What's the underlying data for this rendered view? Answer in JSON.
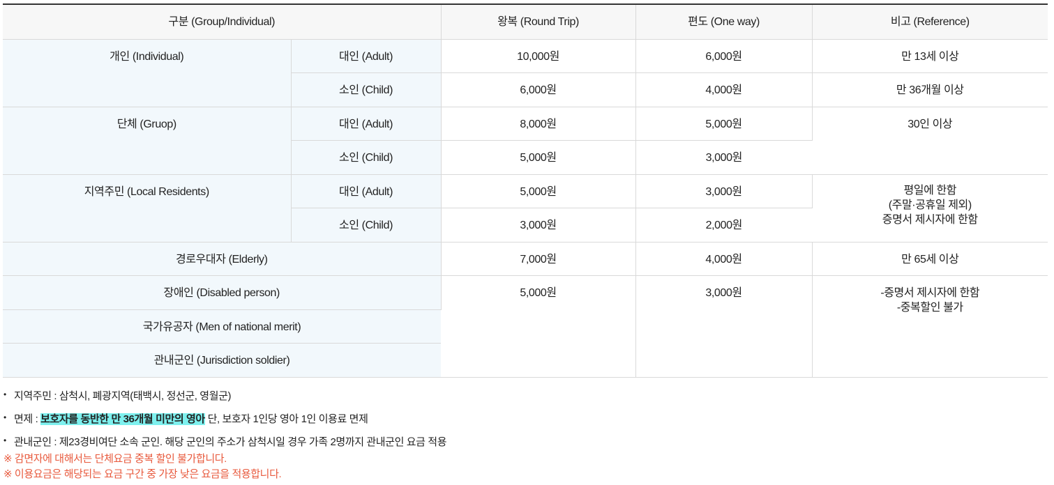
{
  "table": {
    "headers": {
      "group": "구분 (Group/Individual)",
      "round_trip": "왕복 (Round Trip)",
      "one_way": "편도 (One way)",
      "reference": "비고 (Reference)"
    },
    "individual": {
      "label": "개인 (Individual)",
      "adult": {
        "label": "대인 (Adult)",
        "round": "10,000원",
        "oneway": "6,000원",
        "ref": "만 13세 이상"
      },
      "child": {
        "label": "소인 (Child)",
        "round": "6,000원",
        "oneway": "4,000원",
        "ref": "만 36개월 이상"
      }
    },
    "group": {
      "label": "단체 (Gruop)",
      "adult": {
        "label": "대인 (Adult)",
        "round": "8,000원",
        "oneway": "5,000원"
      },
      "child": {
        "label": "소인 (Child)",
        "round": "5,000원",
        "oneway": "3,000원"
      },
      "ref": "30인 이상"
    },
    "local": {
      "label": "지역주민 (Local Residents)",
      "adult": {
        "label": "대인 (Adult)",
        "round": "5,000원",
        "oneway": "3,000원"
      },
      "child": {
        "label": "소인 (Child)",
        "round": "3,000원",
        "oneway": "2,000원"
      },
      "ref": [
        "평일에 한함",
        "(주말·공휴일 제외)",
        "증명서 제시자에 한함"
      ]
    },
    "elderly": {
      "label": "경로우대자 (Elderly)",
      "round": "7,000원",
      "oneway": "4,000원",
      "ref": "만 65세 이상"
    },
    "special": {
      "labels": [
        "장애인 (Disabled person)",
        "국가유공자 (Men of national merit)",
        "관내군인 (Jurisdiction soldier)"
      ],
      "round": "5,000원",
      "oneway": "3,000원",
      "ref": [
        "-증명서 제시자에 한함",
        "-중복할인 불가"
      ]
    }
  },
  "notes": {
    "local": "지역주민 : 삼척시, 폐광지역(태백시, 정선군, 영월군)",
    "exempt_prefix": "면제 : ",
    "exempt_highlight": "보호자를 동반한 만 36개월 미만의 영아",
    "exempt_suffix": " 단, 보호자 1인당 영아 1인 이용료 면제",
    "soldier": "관내군인 : 제23경비여단 소속 군인. 해당 군인의 주소가 삼척시일 경우 가족 2명까지 관내군인 요금 적용",
    "warn1": "※ 감면자에 대해서는 단체요금 중복 할인 불가합니다.",
    "warn2": "※ 이용요금은 해당되는 요금 구간 중 가장 낮은 요금을 적용합니다.",
    "bullet": "•"
  },
  "colors": {
    "label_cell_bg": "#f2f8fc",
    "header_bg": "#f7f7f7",
    "highlight": "#7df0ee",
    "warning": "#e8593c"
  }
}
